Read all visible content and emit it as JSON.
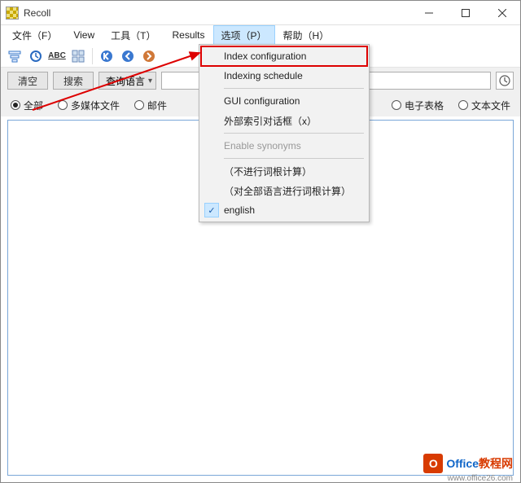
{
  "titlebar": {
    "title": "Recoll"
  },
  "menubar": {
    "file": "文件（F）",
    "view": "View",
    "tools": "工具（T）",
    "results": "Results",
    "options": "选项（P）",
    "help": "帮助（H）"
  },
  "toolbar": {
    "abc": "ABC"
  },
  "search": {
    "clear": "清空",
    "search": "搜索",
    "query_lang": "查询语言",
    "value": ""
  },
  "radios": {
    "all": "全部",
    "media": "多媒体文件",
    "mail": "邮件",
    "spreadsheet": "电子表格",
    "text": "文本文件"
  },
  "dropdown": {
    "index_config": "Index configuration",
    "index_schedule": "Indexing schedule",
    "gui_config": "GUI configuration",
    "ext_index": "外部索引对话框（x）",
    "enable_syn": "Enable synonyms",
    "no_stem": "（不进行词根计算）",
    "all_stem": "（对全部语言进行词根计算）",
    "english": "english"
  },
  "watermark": {
    "text1": "Office",
    "text2": "教程网",
    "sub": "www.office26.com"
  }
}
